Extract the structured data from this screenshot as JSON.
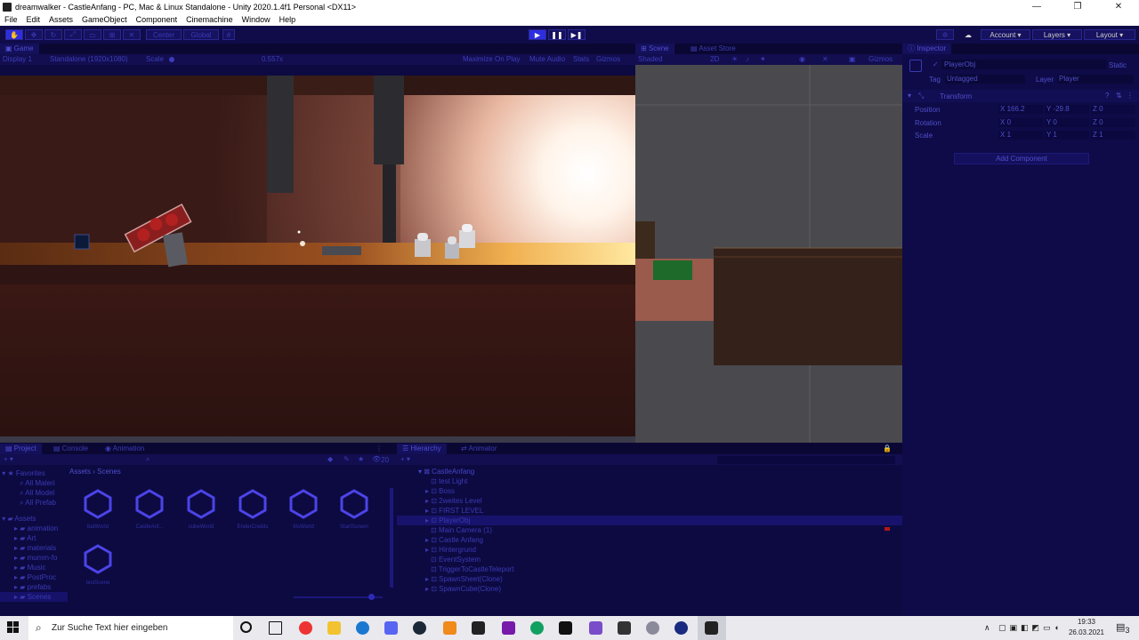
{
  "window": {
    "title": "dreamwalker - CastleAnfang - PC, Mac & Linux Standalone - Unity 2020.1.4f1 Personal <DX11>",
    "minimize": "—",
    "maximize": "❐",
    "close": "✕"
  },
  "menu": [
    "File",
    "Edit",
    "Assets",
    "GameObject",
    "Component",
    "Cinemachine",
    "Window",
    "Help"
  ],
  "toolbar": {
    "pivot": "Center",
    "space": "Global",
    "account": "Account",
    "layers": "Layers",
    "layout": "Layout"
  },
  "game_view": {
    "tab": "Game",
    "display": "Display 1",
    "resolution": "Standalone (1920x1080)",
    "scale_label": "Scale",
    "scale_value": "0.557x",
    "maximize_on_play": "Maximize On Play",
    "mute_audio": "Mute Audio",
    "stats": "Stats",
    "gizmos": "Gizmos"
  },
  "scene_view": {
    "tabs": [
      "Scene",
      "Asset Store"
    ],
    "shading": "Shaded",
    "mode_2d": "2D",
    "gizmos": "Gizmos"
  },
  "inspector": {
    "tab": "Inspector",
    "object_name": "PlayerObj",
    "static_label": "Static",
    "tag_label": "Tag",
    "tag_value": "Untagged",
    "layer_label": "Layer",
    "layer_value": "Player",
    "component": "Transform",
    "position": {
      "label": "Position",
      "x": "166.2",
      "y": "-29.8",
      "z": "0"
    },
    "rotation": {
      "label": "Rotation",
      "x": "0",
      "y": "0",
      "z": "0"
    },
    "scale": {
      "label": "Scale",
      "x": "1",
      "y": "1",
      "z": "1"
    },
    "add_component": "Add Component"
  },
  "project": {
    "tabs": [
      "Project",
      "Console",
      "Animation"
    ],
    "counter": "20",
    "favorites": "Favorites",
    "favorites_items": [
      "All Materi",
      "All Model",
      "All Prefab"
    ],
    "assets_root": "Assets",
    "folders": [
      "animation",
      "Art",
      "materials",
      "mumm-fo",
      "Music",
      "PostProc",
      "prefabs",
      "Scenes"
    ],
    "breadcrumb": [
      "Assets",
      "Scenes"
    ],
    "scene_assets": [
      "batWorld",
      "CastleAnf...",
      "cubeWorld",
      "EnderCredits",
      "IrisWorld",
      "StartScreen",
      "testScene"
    ]
  },
  "hierarchy": {
    "tabs": [
      "Hierarchy",
      "Animator"
    ],
    "root": "CastleAnfang",
    "items": [
      "test Light",
      "Boss",
      "2weites Level",
      "FIRST LEVEL",
      "PlayerObj",
      "Main Camera (1)",
      "Castle Anfang",
      "Hintergrund",
      "EventSystem",
      "TriggerToCastleTeleport",
      "SpawnSheet(Clone)",
      "SpawnCube(Clone)"
    ]
  },
  "taskbar": {
    "search_placeholder": "Zur Suche Text hier eingeben",
    "time": "19:33",
    "date": "26.03.2021",
    "notifications": "3"
  }
}
